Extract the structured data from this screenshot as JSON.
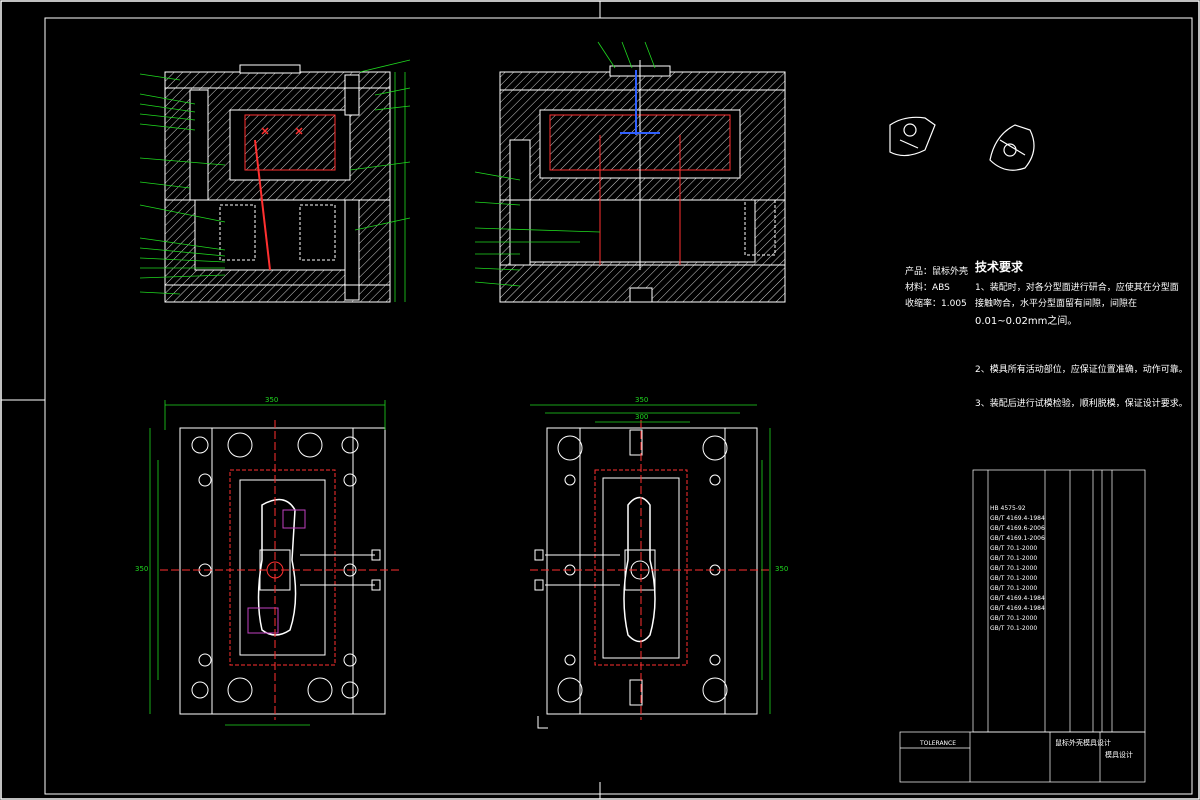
{
  "product": {
    "name": "产品：鼠标外壳",
    "material": "材料：ABS",
    "shrinkage": "收缩率：1.005"
  },
  "tech_requirements": {
    "title": "技术要求",
    "items": [
      "1、装配时，对各分型面进行研合，应使其在分型面",
      "接触吻合，水平分型面留有间隙，间隙在",
      "0.01~0.02mm之间。",
      "2、模具所有活动部位，应保证位置准确，动作可靠。",
      "3、装配后进行试模检验，顺利脱模，保证设计要求。"
    ]
  },
  "dims": {
    "left_width": "350",
    "right_width_outer": "350",
    "right_width_inner": "300",
    "right_height": "350",
    "left_height": "350"
  },
  "title_block": {
    "drawing_title": "鼠标外壳模具设计",
    "tolerance_label": "TOLERANCE",
    "drawn_no": "模具设计"
  },
  "bom_rows": [
    "HB 4575-92",
    "GB/T 4169.4-1984",
    "GB/T 4169.6-2006",
    "GB/T 4169.1-2006",
    "GB/T 70.1-2000",
    "GB/T 70.1-2000",
    "GB/T 70.1-2000",
    "GB/T 70.1-2000",
    "GB/T 70.1-2000",
    "GB/T 4169.4-1984",
    "GB/T 4169.4-1984",
    "GB/T 70.1-2000",
    "GB/T 70.1-2000"
  ]
}
